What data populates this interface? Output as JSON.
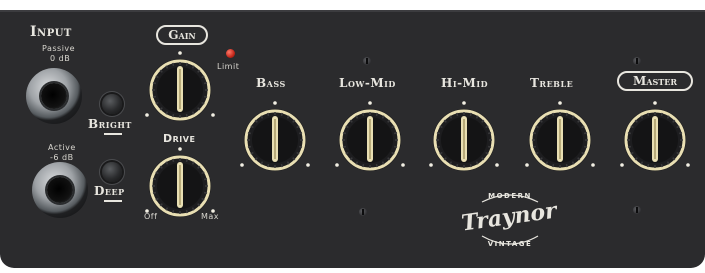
{
  "input": {
    "title": "Input",
    "passive_label": "Passive",
    "passive_db": "0 dB",
    "active_label": "Active",
    "active_db": "-6 dB",
    "bright_label": "Bright",
    "deep_label": "Deep"
  },
  "gain": {
    "title": "Gain",
    "limit_label": "Limit",
    "drive_label": "Drive",
    "off_label": "Off",
    "max_label": "Max"
  },
  "eq": {
    "bass_label": "Bass",
    "lowmid_label": "Low-Mid",
    "himid_label": "Hi-Mid",
    "treble_label": "Treble"
  },
  "master": {
    "title": "Master"
  },
  "logo": {
    "brand": "Traynor",
    "line_top": "MODERN",
    "line_bottom": "VINTAGE"
  },
  "colors": {
    "panel": "#2b2b2d",
    "label": "#e8e6df",
    "led": "#c4271a"
  }
}
